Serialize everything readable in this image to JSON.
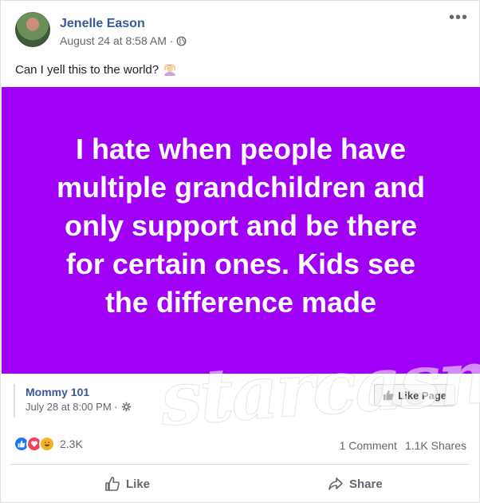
{
  "post": {
    "author": "Jenelle Eason",
    "timestamp": "August 24 at 8:58 AM · ",
    "privacy_icon": "globe-icon",
    "more_label": "•••",
    "caption": "Can I yell this to the world?",
    "caption_emoji": "person-gesturing-ok-emoji"
  },
  "shared": {
    "text": "I hate when people have multiple grandchildren and only support and be there for certain ones. Kids see the difference made",
    "background_color": "#a100f6",
    "page_name": "Mommy 101",
    "page_timestamp": "July 28 at 8:00 PM · ",
    "like_page_label": "Like Page"
  },
  "watermark": "starcasm",
  "engagement": {
    "reaction_count": "2.3K",
    "comments": "1 Comment",
    "shares": "1.1K Shares"
  },
  "actions": {
    "like_label": "Like",
    "share_label": "Share"
  },
  "colors": {
    "link_blue": "#385898",
    "like_blue": "#1877f2",
    "love_red": "#f33e58",
    "haha_yellow": "#f7b125"
  }
}
